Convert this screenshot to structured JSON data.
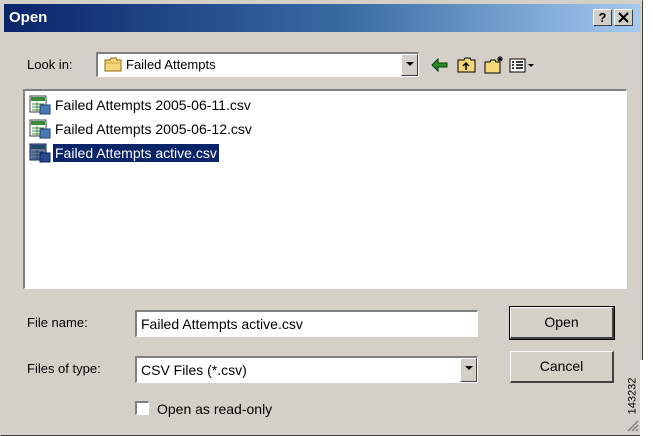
{
  "window": {
    "title": "Open",
    "help_button": "?",
    "close_button": "✕"
  },
  "look_in": {
    "label": "Look in:",
    "value": "Failed Attempts",
    "folder_icon": "folder-icon"
  },
  "toolbar": {
    "icons": [
      "back-arrow-icon",
      "up-folder-icon",
      "new-folder-icon",
      "view-menu-icon"
    ]
  },
  "files": [
    {
      "name": "Failed Attempts 2005-06-11.csv",
      "icon": "csv-file-icon",
      "selected": false
    },
    {
      "name": "Failed Attempts 2005-06-12.csv",
      "icon": "csv-file-icon",
      "selected": false
    },
    {
      "name": "Failed Attempts active.csv",
      "icon": "csv-file-icon",
      "selected": true
    }
  ],
  "file_name": {
    "label": "File name:",
    "value": "Failed Attempts active.csv"
  },
  "file_type": {
    "label": "Files of type:",
    "value": "CSV Files (*.csv)"
  },
  "buttons": {
    "open": "Open",
    "cancel": "Cancel"
  },
  "read_only": {
    "label": "Open as read-only",
    "checked": false
  },
  "figure_id": "143232",
  "colors": {
    "selection": "#0a246a",
    "title_gradient_start": "#0a246a",
    "title_gradient_end": "#a6caf0",
    "face": "#d4d0c8"
  }
}
